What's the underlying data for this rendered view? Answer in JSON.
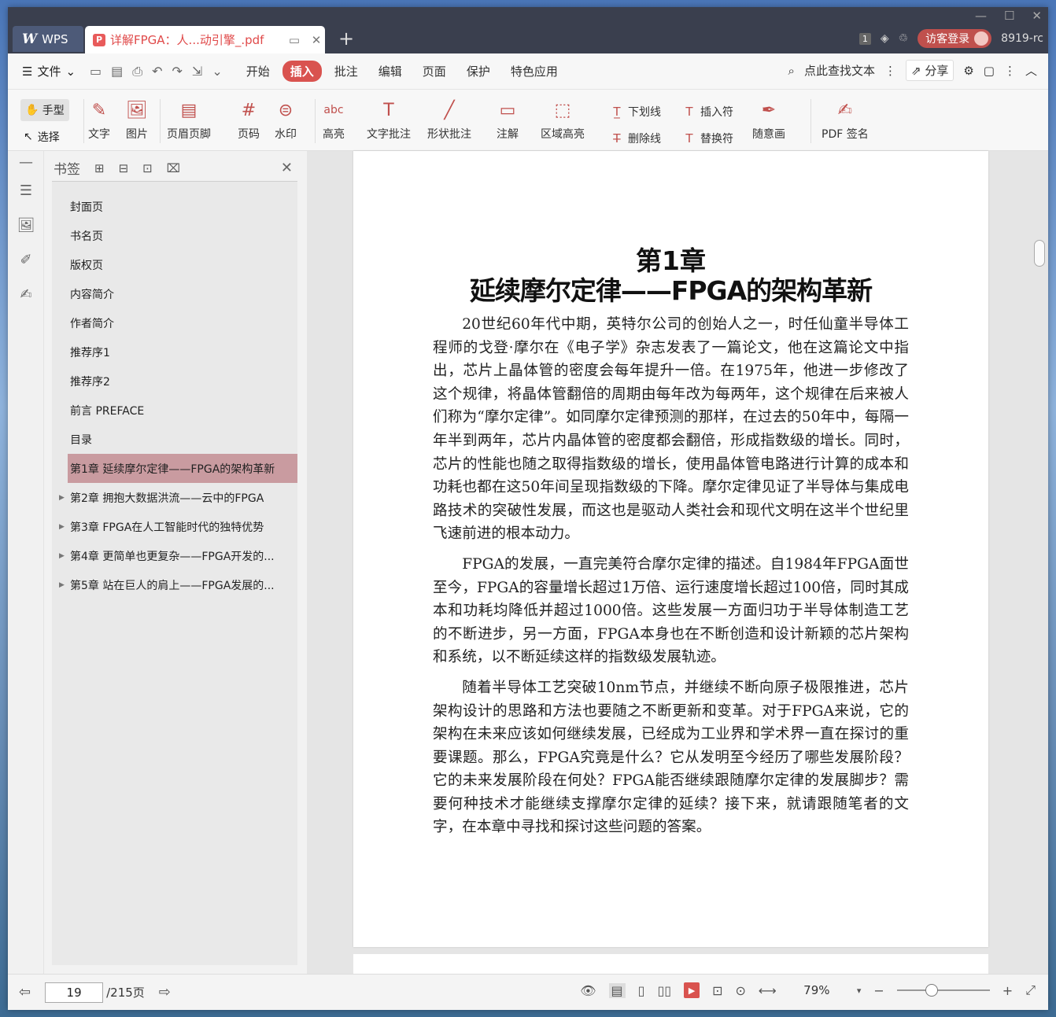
{
  "titlebar": {
    "app_tab": "WPS",
    "doc_tab": "详解FPGA：人...动引擎_.pdf",
    "badge": "1",
    "login": "访客登录",
    "account": "8919-rc"
  },
  "menubar": {
    "file": "文件",
    "tabs": [
      "开始",
      "插入",
      "批注",
      "编辑",
      "页面",
      "保护",
      "特色应用"
    ],
    "active_tab": "插入",
    "search": "点此查找文本",
    "share": "分享"
  },
  "ribbon": {
    "hand": "手型",
    "select": "选择",
    "text": "文字",
    "image": "图片",
    "header_footer": "页眉页脚",
    "page_num": "页码",
    "watermark": "水印",
    "highlight": "高亮",
    "text_comment": "文字批注",
    "shape_comment": "形状批注",
    "annotation": "注解",
    "area_highlight": "区域高亮",
    "underline": "下划线",
    "strikethrough": "删除线",
    "insert_mark": "插入符",
    "replace_mark": "替换符",
    "freehand": "随意画",
    "pdf_sign": "PDF 签名"
  },
  "bookmarks": {
    "title": "书签",
    "items": [
      {
        "label": "封面页"
      },
      {
        "label": "书名页"
      },
      {
        "label": "版权页"
      },
      {
        "label": "内容简介"
      },
      {
        "label": "作者简介"
      },
      {
        "label": "推荐序1"
      },
      {
        "label": "推荐序2"
      },
      {
        "label": "前言 PREFACE"
      },
      {
        "label": "目录"
      },
      {
        "label": "第1章 延续摩尔定律——FPGA的架构革新"
      },
      {
        "label": "第2章 拥抱大数据洪流——云中的FPGA"
      },
      {
        "label": "第3章 FPGA在人工智能时代的独特优势"
      },
      {
        "label": "第4章 更简单也更复杂——FPGA开发的..."
      },
      {
        "label": "第5章 站在巨人的肩上——FPGA发展的..."
      }
    ]
  },
  "document": {
    "chapter": "第1章",
    "title": "延续摩尔定律——FPGA的架构革新",
    "paragraphs": [
      "20世纪60年代中期，英特尔公司的创始人之一，时任仙童半导体工程师的戈登·摩尔在《电子学》杂志发表了一篇论文，他在这篇论文中指出，芯片上晶体管的密度会每年提升一倍。在1975年，他进一步修改了这个规律，将晶体管翻倍的周期由每年改为每两年，这个规律在后来被人们称为“摩尔定律”。如同摩尔定律预测的那样，在过去的50年中，每隔一年半到两年，芯片内晶体管的密度都会翻倍，形成指数级的增长。同时，芯片的性能也随之取得指数级的增长，使用晶体管电路进行计算的成本和功耗也都在这50年间呈现指数级的下降。摩尔定律见证了半导体与集成电路技术的突破性发展，而这也是驱动人类社会和现代文明在这半个世纪里飞速前进的根本动力。",
      "FPGA的发展，一直完美符合摩尔定律的描述。自1984年FPGA面世至今，FPGA的容量增长超过1万倍、运行速度增长超过100倍，同时其成本和功耗均降低并超过1000倍。这些发展一方面归功于半导体制造工艺的不断进步，另一方面，FPGA本身也在不断创造和设计新颖的芯片架构和系统，以不断延续这样的指数级发展轨迹。",
      "随着半导体工艺突破10nm节点，并继续不断向原子极限推进，芯片架构设计的思路和方法也要随之不断更新和变革。对于FPGA来说，它的架构在未来应该如何继续发展，已经成为工业界和学术界一直在探讨的重要课题。那么，FPGA究竟是什么？它从发明至今经历了哪些发展阶段？它的未来发展阶段在何处？FPGA能否继续跟随摩尔定律的发展脚步？需要何种技术才能继续支撑摩尔定律的延续？接下来，就请跟随笔者的文字，在本章中寻找和探讨这些问题的答案。"
    ]
  },
  "statusbar": {
    "current_page": "19",
    "total": "/215页",
    "zoom": "79%"
  }
}
